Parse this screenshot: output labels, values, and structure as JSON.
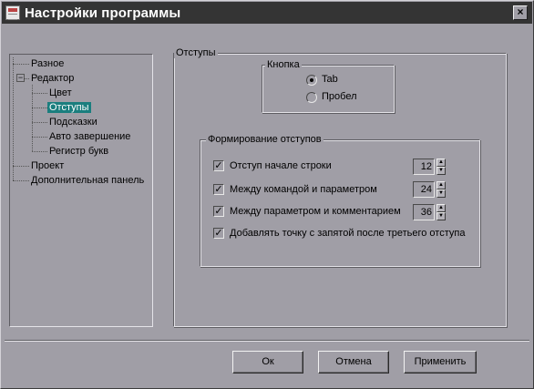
{
  "window": {
    "title": "Настройки программы",
    "close_glyph": "×"
  },
  "tree": {
    "items": [
      {
        "label": "Разное"
      },
      {
        "label": "Редактор",
        "expander": "−"
      },
      {
        "label": "Цвет"
      },
      {
        "label": "Отступы",
        "selected": true
      },
      {
        "label": "Подсказки"
      },
      {
        "label": "Авто завершение"
      },
      {
        "label": "Регистр букв"
      },
      {
        "label": "Проект"
      },
      {
        "label": "Дополнительная панель"
      }
    ]
  },
  "panel": {
    "legend": "Отступы",
    "button_group": {
      "legend": "Кнопка",
      "options": [
        {
          "label": "Tab",
          "checked": true
        },
        {
          "label": "Пробел",
          "checked": false
        }
      ]
    },
    "formation_group": {
      "legend": "Формирование отступов",
      "rows": [
        {
          "label": "Отступ начале строки",
          "checked": true,
          "value": "12"
        },
        {
          "label": "Между командой и параметром",
          "checked": true,
          "value": "24"
        },
        {
          "label": "Между параметром и комментарием",
          "checked": true,
          "value": "36"
        },
        {
          "label": "Добавлять точку с запятой после третьего отступа",
          "checked": true
        }
      ],
      "check_glyph": "✓",
      "spin_up_glyph": "▲",
      "spin_down_glyph": "▼"
    }
  },
  "footer": {
    "ok_label": "Ок",
    "cancel_label": "Отмена",
    "apply_label": "Применить"
  }
}
